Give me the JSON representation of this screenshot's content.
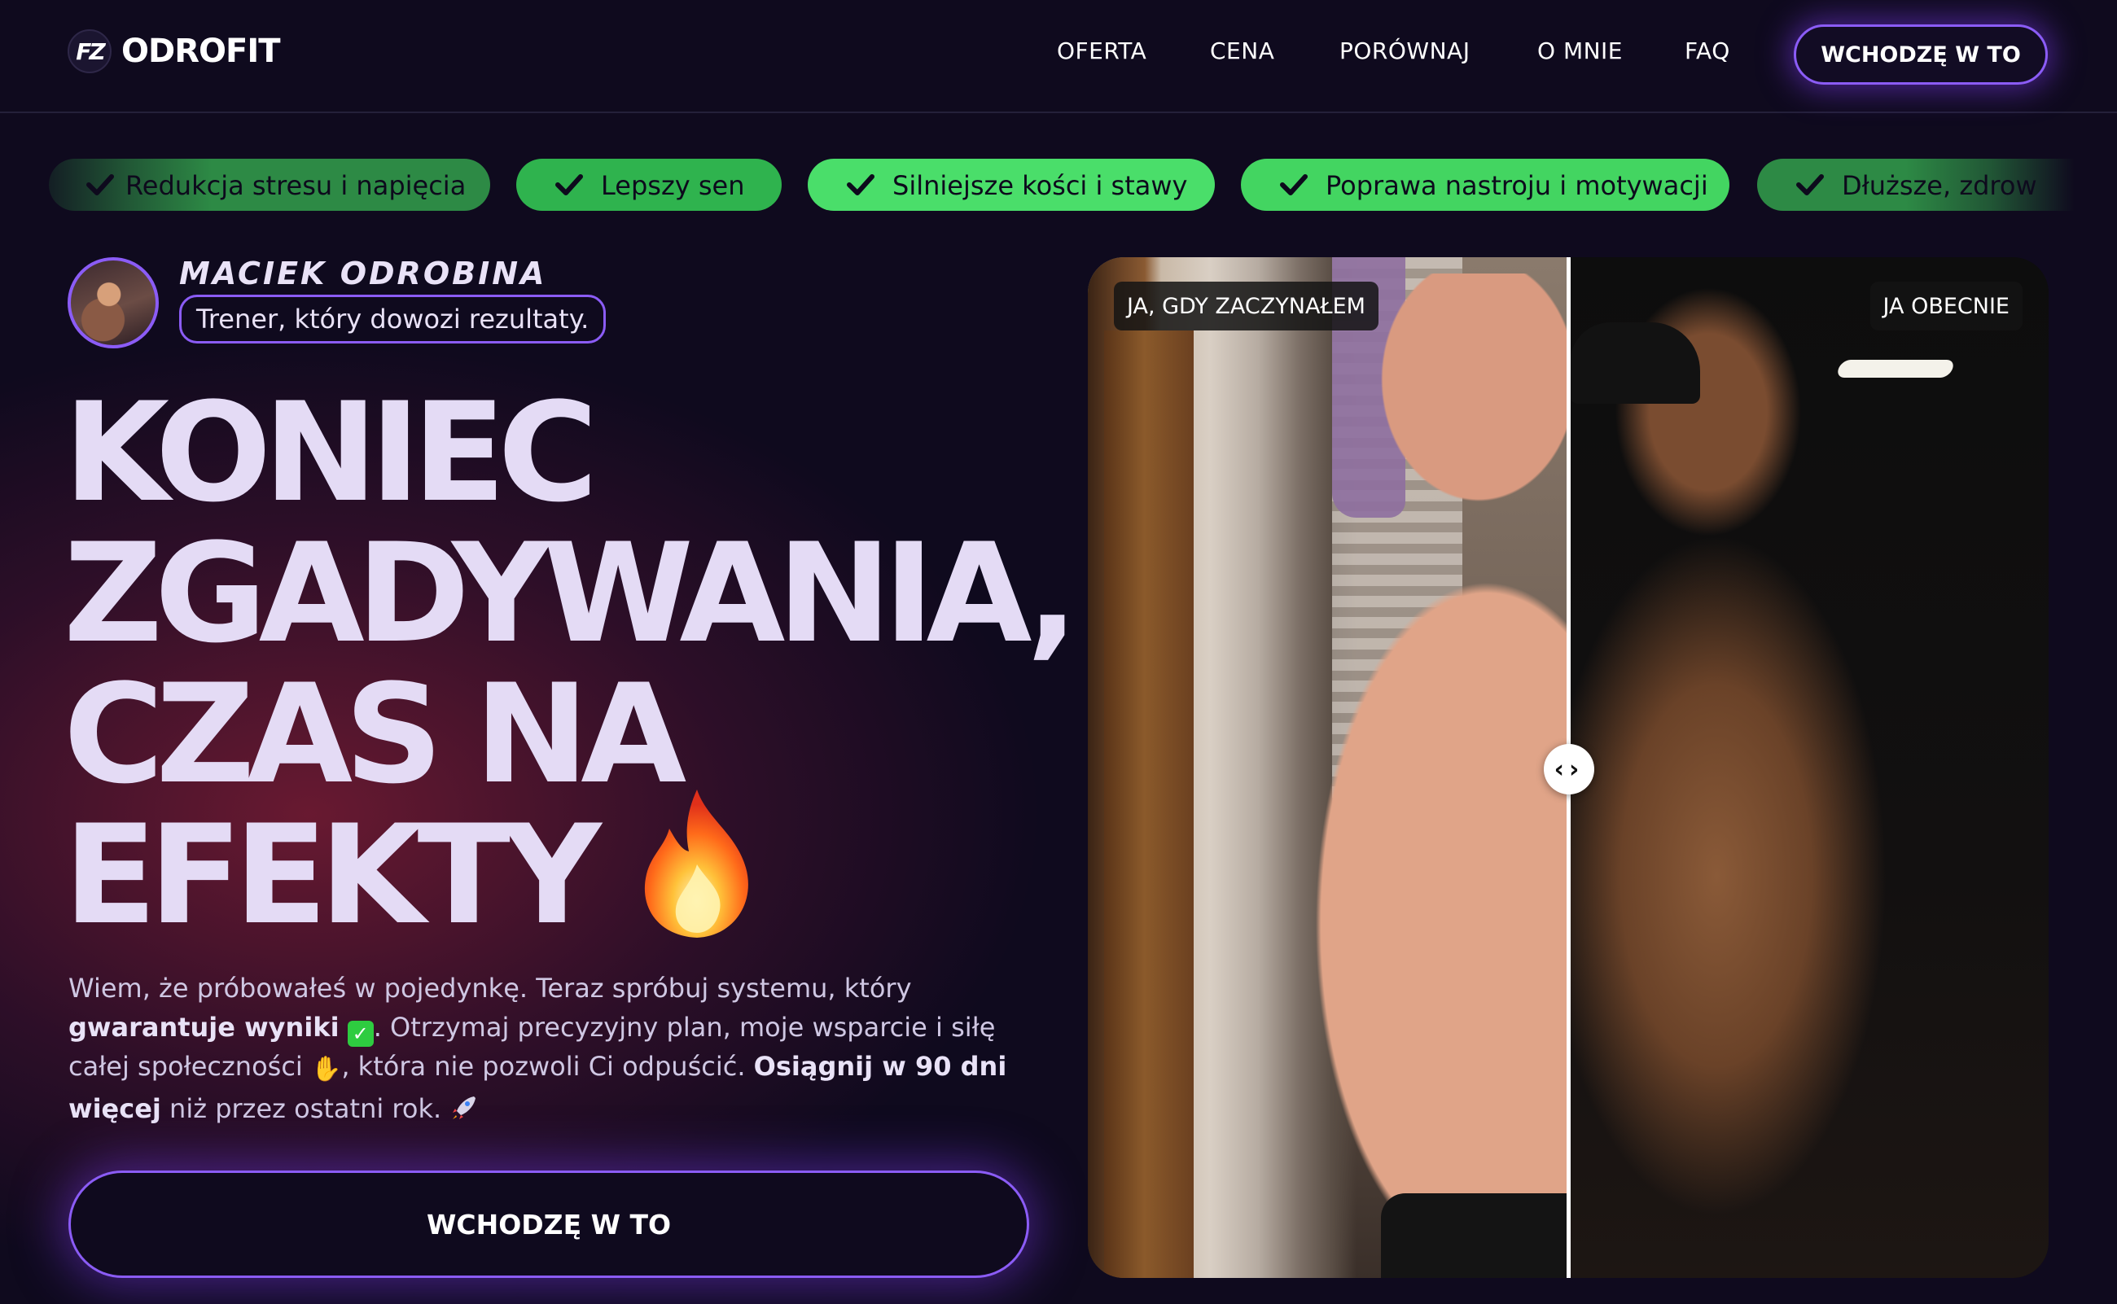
{
  "header": {
    "logo_mark": "FZ",
    "logo_text": "ODROFIT",
    "nav": [
      "OFERTA",
      "CENA",
      "PORÓWNAJ",
      "O MNIE",
      "FAQ"
    ],
    "cta_label": "WCHODZĘ W TO"
  },
  "benefits": [
    "Redukcja stresu i napięcia",
    "Lepszy sen",
    "Silniejsze kości i stawy",
    "Poprawa nastroju i motywacji",
    "Dłuższe, zdrow"
  ],
  "author": {
    "name": "MACIEK ODROBINA",
    "tagline": "Trener, który dowozi rezultaty."
  },
  "headline": [
    "KONIEC",
    "ZGADYWANIA,",
    "CZAS NA",
    "EFEKTY"
  ],
  "headline_emoji": "fire-icon",
  "description": {
    "part1": "Wiem, że próbowałeś w pojedynkę. Teraz spróbuj systemu, który ",
    "bold1": "gwarantuje wyniki",
    "part2": ". Otrzymaj precyzyjny plan, moje wsparcie i siłę całej społeczności ",
    "part3": ", która nie pozwoli Ci odpuścić. ",
    "bold2": "Osiągnij w 90 dni więcej",
    "part4": " niż przez ostatni rok. "
  },
  "main_cta_label": "WCHODZĘ W TO",
  "comparison": {
    "before_label": "JA, GDY ZACZYNAŁEM",
    "after_label": "JA OBECNIE",
    "handle_glyph": "‹›"
  },
  "colors": {
    "background": "#0f0a1e",
    "accent": "#8b5cf6",
    "pill_green": "#4ade6a",
    "headline": "#e4dbf5"
  }
}
